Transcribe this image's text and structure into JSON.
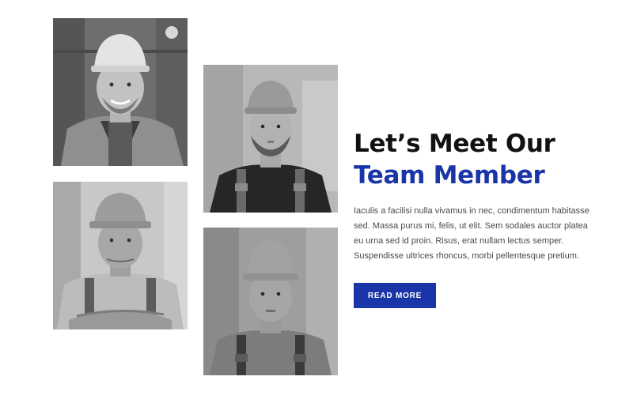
{
  "team_section": {
    "heading_line_1": "Let’s Meet Our",
    "heading_line_2": "Team Member",
    "description": "Iaculis a facilisi nulla vivamus in nec, condimentum habitasse sed. Massa purus mi, felis, ut elit. Sem sodales auctor platea eu urna sed id proin. Risus, erat nullam lectus semper. Suspendisse ultrices rhoncus, morbi pellentesque pretium.",
    "button_label": "READ MORE"
  },
  "colors": {
    "accent": "#1a35a8",
    "heading_dark": "#111111",
    "body_text": "#4a4a4a"
  }
}
